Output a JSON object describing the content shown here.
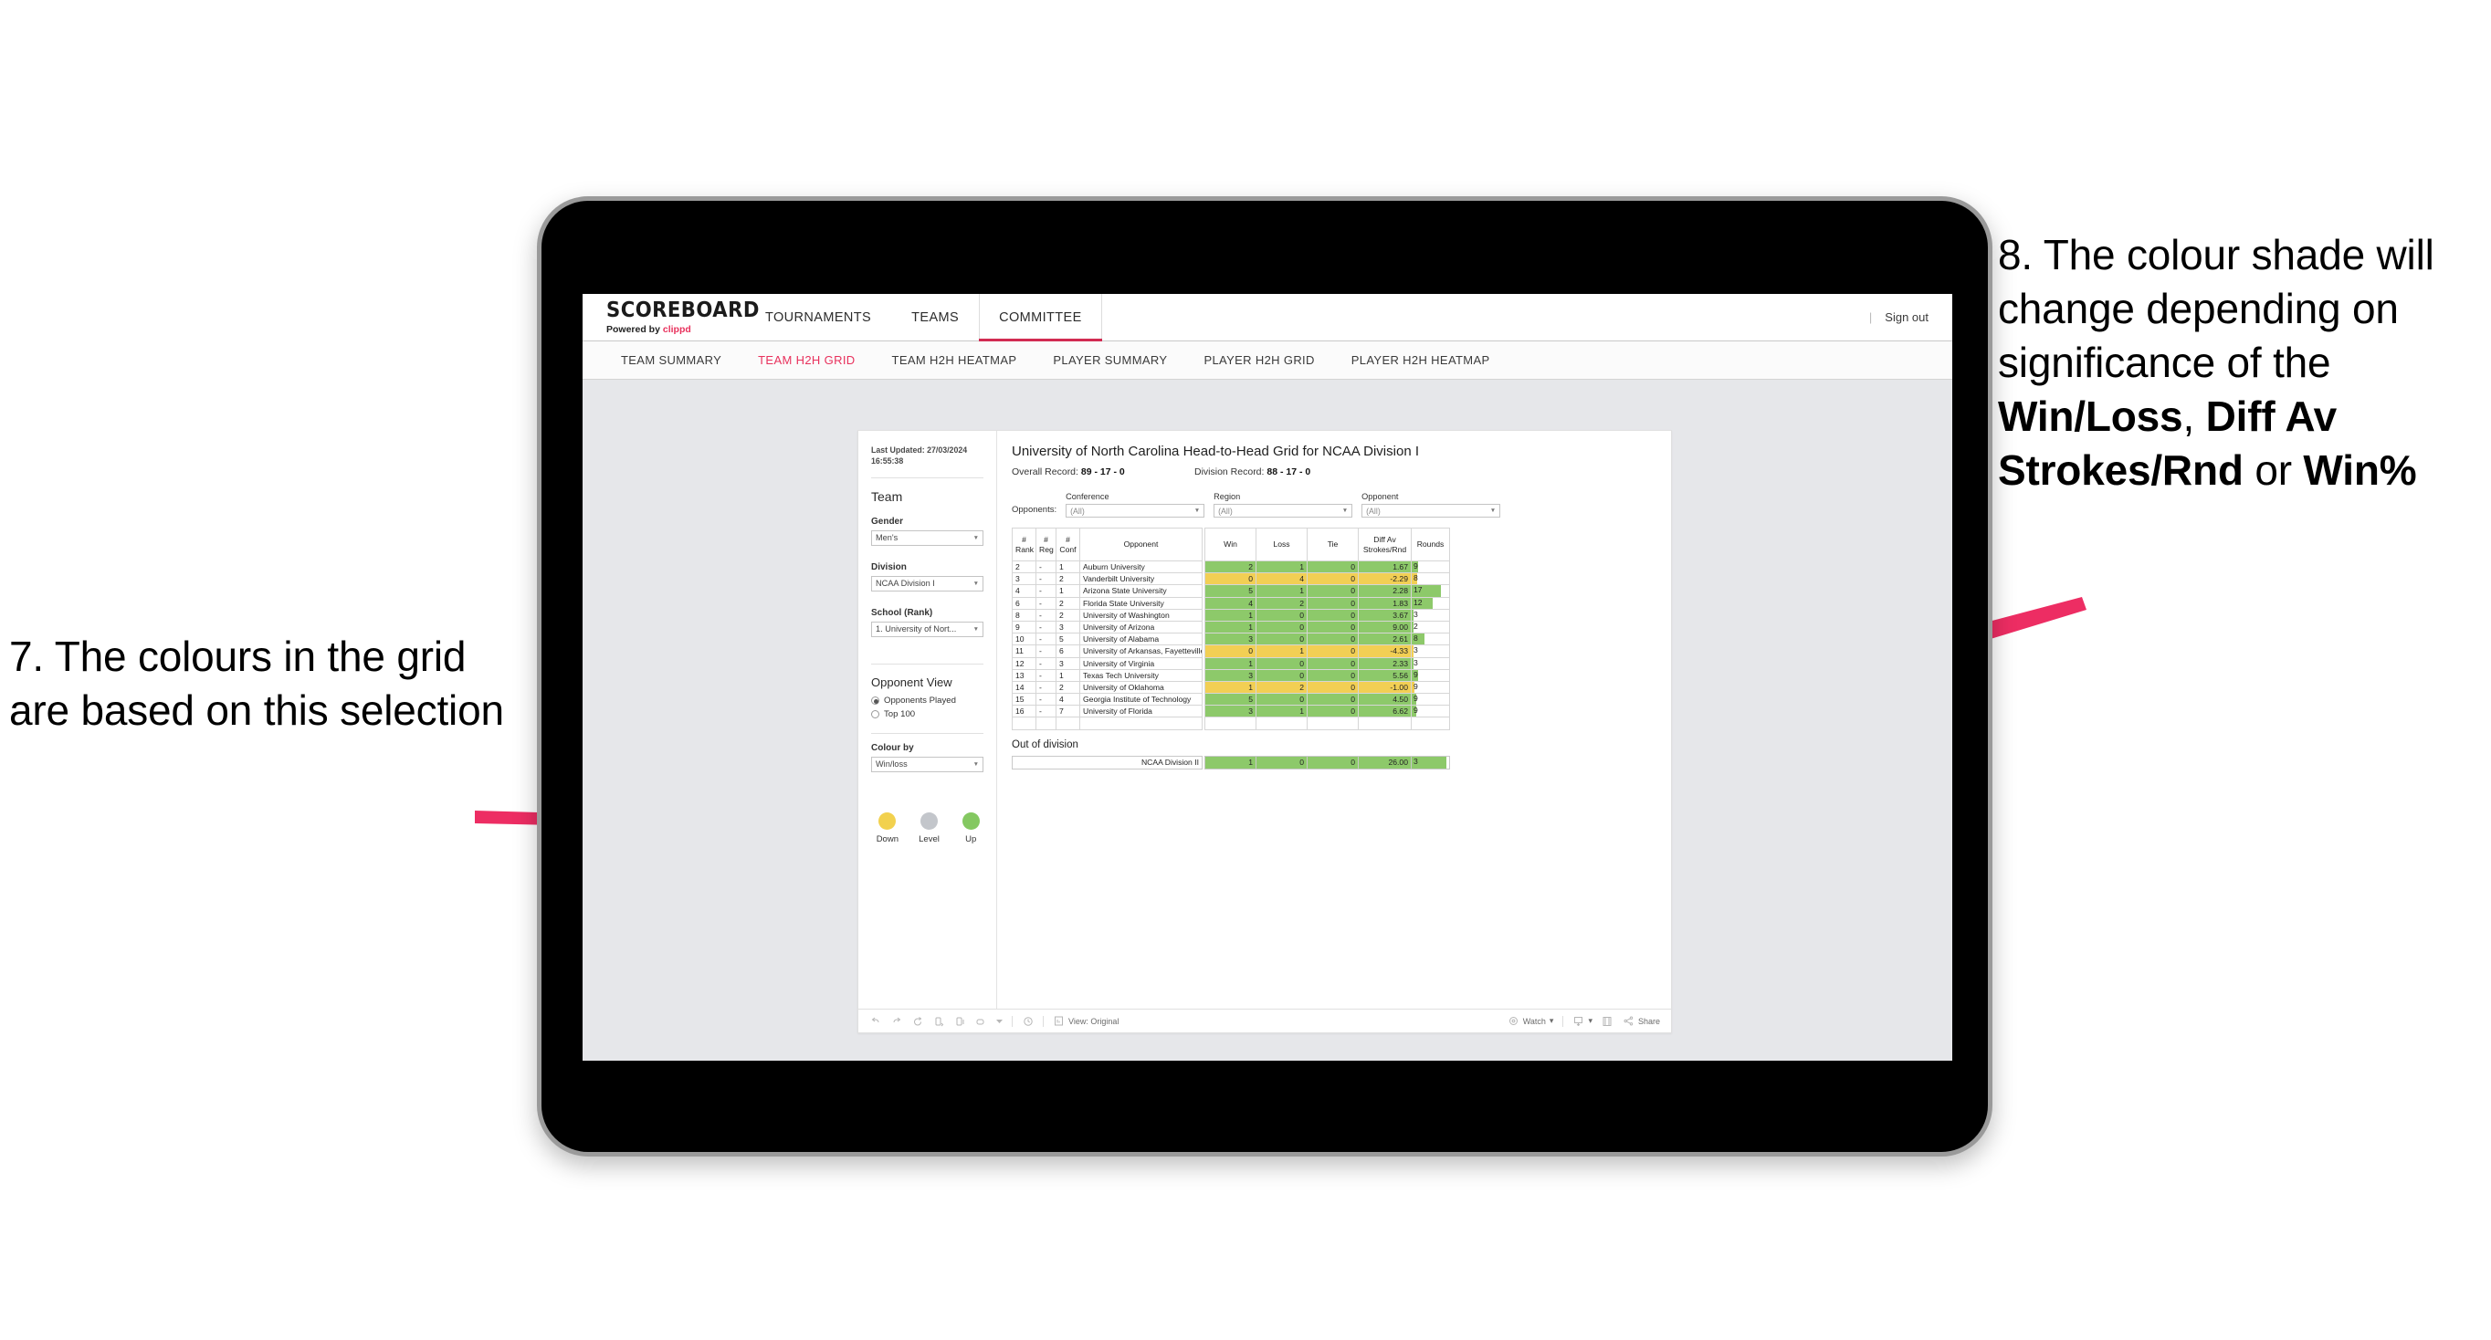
{
  "annotations": {
    "left": {
      "number": "7.",
      "text": "7. The colours in the grid are based on this selection"
    },
    "right": {
      "line1": "8. The colour shade will change depending on significance of the ",
      "bold1": "Win/Loss",
      "mid1": ", ",
      "bold2": "Diff Av Strokes/Rnd",
      "mid2": " or ",
      "bold3": "Win%"
    },
    "arrow_color": "#ED2D63"
  },
  "app": {
    "brand": {
      "title": "SCOREBOARD",
      "sub_prefix": "Powered by ",
      "sub_accent": "clippd"
    },
    "top_tabs": [
      {
        "label": "TOURNAMENTS",
        "active": false
      },
      {
        "label": "TEAMS",
        "active": false
      },
      {
        "label": "COMMITTEE",
        "active": true
      }
    ],
    "header_right": {
      "separator": "|",
      "sign_out": "Sign out"
    },
    "sub_tabs": [
      {
        "label": "TEAM SUMMARY",
        "active": false
      },
      {
        "label": "TEAM H2H GRID",
        "active": true
      },
      {
        "label": "TEAM H2H HEATMAP",
        "active": false
      },
      {
        "label": "PLAYER SUMMARY",
        "active": false
      },
      {
        "label": "PLAYER H2H GRID",
        "active": false
      },
      {
        "label": "PLAYER H2H HEATMAP",
        "active": false
      }
    ],
    "accent_color": "#E8315C"
  },
  "panel": {
    "last_updated": "Last Updated: 27/03/2024 16:55:38",
    "team_heading": "Team",
    "gender_label": "Gender",
    "gender_value": "Men's",
    "division_label": "Division",
    "division_value": "NCAA Division I",
    "school_label": "School (Rank)",
    "school_value": "1. University of Nort...",
    "opponent_view_heading": "Opponent View",
    "radio_opponents_played": "Opponents Played",
    "radio_top_100": "Top 100",
    "colour_by_label": "Colour by",
    "colour_by_value": "Win/loss",
    "legend": [
      {
        "label": "Down",
        "color": "#F2D14E"
      },
      {
        "label": "Level",
        "color": "#C3C6CB"
      },
      {
        "label": "Up",
        "color": "#84C861"
      }
    ]
  },
  "viz": {
    "title": "University of North Carolina Head-to-Head Grid for NCAA Division I",
    "overall_record_label": "Overall Record: ",
    "overall_record_value": "89 - 17 - 0",
    "division_record_label": "Division Record: ",
    "division_record_value": "88 - 17 - 0",
    "opponents_label": "Opponents:",
    "filters": [
      {
        "label": "Conference",
        "value": "(All)"
      },
      {
        "label": "Region",
        "value": "(All)"
      },
      {
        "label": "Opponent",
        "value": "(All)"
      }
    ],
    "columns": [
      "# Rank",
      "# Reg",
      "# Conf",
      "Opponent",
      "Win",
      "Loss",
      "Tie",
      "Diff Av Strokes/Rnd",
      "Rounds"
    ],
    "column_lines": [
      [
        "#",
        "Rank"
      ],
      [
        "#",
        "Reg"
      ],
      [
        "#",
        "Conf"
      ],
      [
        "",
        "Opponent"
      ],
      [
        "",
        "Win"
      ],
      [
        "",
        "Loss"
      ],
      [
        "",
        "Tie"
      ],
      [
        "Diff Av",
        "Strokes/Rnd"
      ],
      [
        "",
        "Rounds"
      ]
    ],
    "out_of_division_label": "Out of division",
    "out_of_division_row": {
      "name": "NCAA Division II",
      "win": "1",
      "loss": "0",
      "tie": "0",
      "diff": "26.00",
      "rounds": "3",
      "color": "#8DC96A",
      "rounds_fill": 92
    }
  },
  "chart_data": {
    "type": "table",
    "title": "University of North Carolina Head-to-Head Grid for NCAA Division I",
    "colour_by": "Win/loss",
    "colors": {
      "up": "#8DC96A",
      "down": "#F2CF54",
      "level": "#C3C6CB"
    },
    "columns": [
      "#Rank",
      "#Reg",
      "#Conf",
      "Opponent",
      "Win",
      "Loss",
      "Tie",
      "Diff Av Strokes/Rnd",
      "Rounds"
    ],
    "rows": [
      {
        "rank": "2",
        "reg": "-",
        "conf": "1",
        "opponent": "Auburn University",
        "win": "2",
        "loss": "1",
        "tie": "0",
        "diff": "1.67",
        "rounds": "9",
        "color": "#8DC96A",
        "rounds_fill": 16
      },
      {
        "rank": "3",
        "reg": "-",
        "conf": "2",
        "opponent": "Vanderbilt University",
        "win": "0",
        "loss": "4",
        "tie": "0",
        "diff": "-2.29",
        "rounds": "8",
        "color": "#F2CF54",
        "rounds_fill": 14
      },
      {
        "rank": "4",
        "reg": "-",
        "conf": "1",
        "opponent": "Arizona State University",
        "win": "5",
        "loss": "1",
        "tie": "0",
        "diff": "2.28",
        "rounds": "17",
        "color": "#8DC96A",
        "rounds_fill": 78
      },
      {
        "rank": "6",
        "reg": "-",
        "conf": "2",
        "opponent": "Florida State University",
        "win": "4",
        "loss": "2",
        "tie": "0",
        "diff": "1.83",
        "rounds": "12",
        "color": "#8DC96A",
        "rounds_fill": 55
      },
      {
        "rank": "8",
        "reg": "-",
        "conf": "2",
        "opponent": "University of Washington",
        "win": "1",
        "loss": "0",
        "tie": "0",
        "diff": "3.67",
        "rounds": "3",
        "color": "#8DC96A",
        "rounds_fill": 5
      },
      {
        "rank": "9",
        "reg": "-",
        "conf": "3",
        "opponent": "University of Arizona",
        "win": "1",
        "loss": "0",
        "tie": "0",
        "diff": "9.00",
        "rounds": "2",
        "color": "#8DC96A",
        "rounds_fill": 4
      },
      {
        "rank": "10",
        "reg": "-",
        "conf": "5",
        "opponent": "University of Alabama",
        "win": "3",
        "loss": "0",
        "tie": "0",
        "diff": "2.61",
        "rounds": "8",
        "color": "#8DC96A",
        "rounds_fill": 33
      },
      {
        "rank": "11",
        "reg": "-",
        "conf": "6",
        "opponent": "University of Arkansas, Fayetteville",
        "win": "0",
        "loss": "1",
        "tie": "0",
        "diff": "-4.33",
        "rounds": "3",
        "color": "#F2CF54",
        "rounds_fill": 5
      },
      {
        "rank": "12",
        "reg": "-",
        "conf": "3",
        "opponent": "University of Virginia",
        "win": "1",
        "loss": "0",
        "tie": "0",
        "diff": "2.33",
        "rounds": "3",
        "color": "#8DC96A",
        "rounds_fill": 5
      },
      {
        "rank": "13",
        "reg": "-",
        "conf": "1",
        "opponent": "Texas Tech University",
        "win": "3",
        "loss": "0",
        "tie": "0",
        "diff": "5.56",
        "rounds": "9",
        "color": "#8DC96A",
        "rounds_fill": 16
      },
      {
        "rank": "14",
        "reg": "-",
        "conf": "2",
        "opponent": "University of Oklahoma",
        "win": "1",
        "loss": "2",
        "tie": "0",
        "diff": "-1.00",
        "rounds": "9",
        "color": "#F2CF54",
        "rounds_fill": 8
      },
      {
        "rank": "15",
        "reg": "-",
        "conf": "4",
        "opponent": "Georgia Institute of Technology",
        "win": "5",
        "loss": "0",
        "tie": "0",
        "diff": "4.50",
        "rounds": "9",
        "color": "#8DC96A",
        "rounds_fill": 12
      },
      {
        "rank": "16",
        "reg": "-",
        "conf": "7",
        "opponent": "University of Florida",
        "win": "3",
        "loss": "1",
        "tie": "0",
        "diff": "6.62",
        "rounds": "9",
        "color": "#8DC96A",
        "rounds_fill": 12
      }
    ]
  },
  "toolbar": {
    "icons": [
      "undo-icon",
      "redo-icon",
      "revert-icon",
      "refresh-icon",
      "pause-icon",
      "swap-icon"
    ],
    "view_label": "View: Original",
    "watch_label": "Watch",
    "share_label": "Share"
  }
}
